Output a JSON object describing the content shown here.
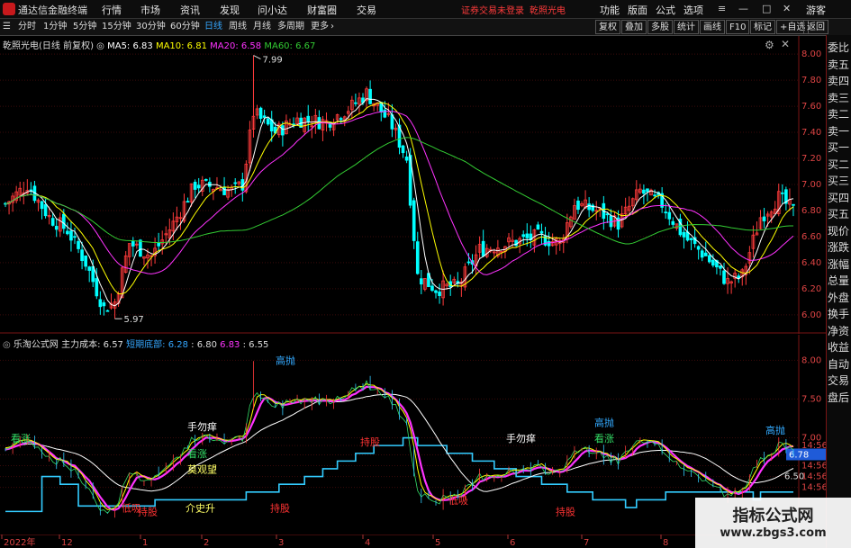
{
  "app": {
    "title": "通达信金融终端"
  },
  "menu": [
    "行情",
    "市场",
    "资讯",
    "发现",
    "问小达",
    "财富圈",
    "交易"
  ],
  "status_text": "证券交易未登录",
  "stock_name_top": "乾照光电",
  "top_right_menu": [
    "功能",
    "版面",
    "公式",
    "选项"
  ],
  "user": "游客",
  "periods": [
    "分时",
    "1分钟",
    "5分钟",
    "15分钟",
    "30分钟",
    "60分钟",
    "日线",
    "周线",
    "月线",
    "多周期",
    "更多"
  ],
  "active_period": "日线",
  "toolbar_right": [
    "复权",
    "叠加",
    "多股",
    "统计",
    "画线",
    "F10",
    "标记",
    "+自选",
    "返回"
  ],
  "main_legend": {
    "name": "乾照光电(日线 前复权)",
    "ma5": "MA5: 6.83",
    "ma10": "MA10: 6.81",
    "ma20": "MA20: 6.58",
    "ma60": "MA60: 6.67"
  },
  "main_ticks": [
    "8.00",
    "7.80",
    "7.60",
    "7.40",
    "7.20",
    "7.00",
    "6.80",
    "6.60",
    "6.40",
    "6.20",
    "6.00"
  ],
  "main_annotations": {
    "high": "7.99",
    "low": "5.97"
  },
  "ind_legend": {
    "name": "乐淘公式网",
    "main_cost": "主力成本: 6.57",
    "short_bottom_label": "短期底部:",
    "v1": "6.28",
    "v2": ": 6.80",
    "v3": "6.83",
    "v4": ": 6.55"
  },
  "ind_ticks": [
    "8.00",
    "7.50",
    "7.00",
    "14:56",
    "14:56",
    "14:56",
    "14:56",
    "14:56"
  ],
  "ind_price_tag": "6.78",
  "ind_tick_650": "6.50",
  "signals": {
    "chipai": "持股",
    "dixi": "低吸",
    "shouwang": "手勿痒",
    "mingzhang": "看涨",
    "guanwang": "莫观望",
    "jieduan": "介史升",
    "gaopao": "高抛"
  },
  "x_axis": [
    "2022年",
    "12",
    "1",
    "2",
    "3",
    "4",
    "5",
    "6",
    "7",
    "8"
  ],
  "right_panel": [
    "委比",
    "卖五",
    "卖四",
    "卖三",
    "卖二",
    "卖一",
    "买一",
    "买二",
    "买三",
    "买四",
    "买五",
    "现价",
    "涨跌",
    "涨幅",
    "总量",
    "外盘",
    "换手",
    "净资",
    "收益",
    "自动",
    "交易",
    "盘后"
  ],
  "watermark": {
    "line1": "指标公式网",
    "line2": "www.zbgs3.com"
  },
  "colors": {
    "up": "#ff3b3b",
    "down": "#00ffff",
    "ma5": "#ffffff",
    "ma10": "#ffff00",
    "ma20": "#ff33ff",
    "ma60": "#33cc33"
  }
}
